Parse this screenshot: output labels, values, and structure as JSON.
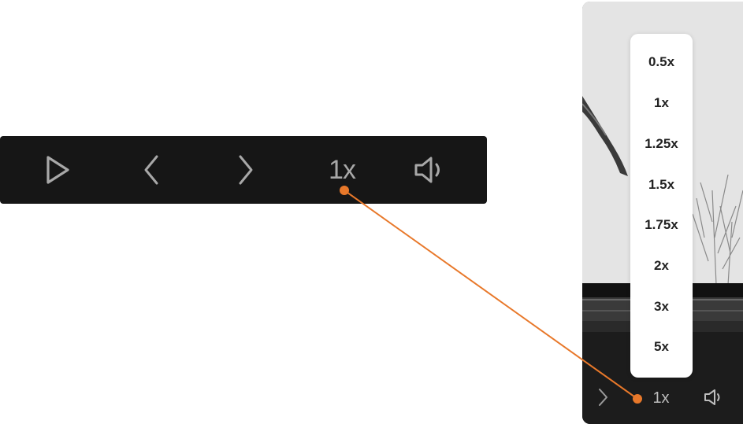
{
  "large_bar": {
    "play_icon": "play-icon",
    "prev_icon": "chevron-left-icon",
    "next_icon": "chevron-right-icon",
    "speed_label": "1x",
    "volume_icon": "volume-icon"
  },
  "preview": {
    "next_icon": "chevron-right-icon",
    "speed_label": "1x",
    "volume_icon": "volume-icon"
  },
  "speed_menu": {
    "options": [
      "0.5x",
      "1x",
      "1.25x",
      "1.5x",
      "1.75x",
      "2x",
      "3x",
      "5x"
    ]
  },
  "colors": {
    "bar_bg": "#161616",
    "icon": "#a8a8a8",
    "callout": "#e8782a",
    "menu_bg": "#ffffff"
  }
}
